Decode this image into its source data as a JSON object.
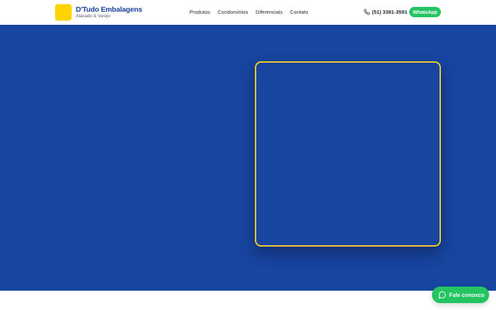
{
  "header": {
    "brand_name": "D'Tudo Embalagens",
    "brand_tagline": "Atacado & Varejo",
    "nav": [
      {
        "label": "Produtos"
      },
      {
        "label": "Condomínios"
      },
      {
        "label": "Diferenciais"
      },
      {
        "label": "Contato"
      }
    ],
    "phone": "(51) 3381-3591",
    "phone_icon": "phone-icon",
    "whatsapp_label": "WhatsApp"
  },
  "floating_chat": {
    "label": "Fale conosco",
    "icon": "chat-bubble-icon"
  },
  "colors": {
    "brand_blue": "#1845a0",
    "brand_yellow": "#ffd400",
    "whatsapp_green": "#25c463"
  }
}
